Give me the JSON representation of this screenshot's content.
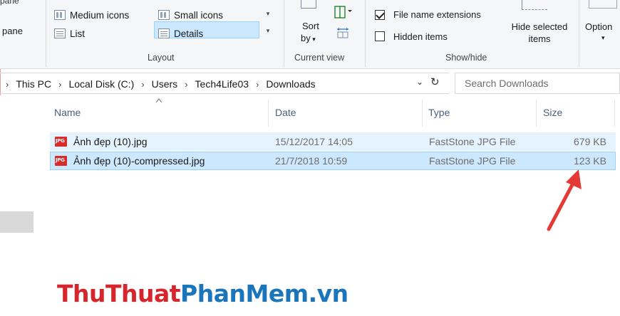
{
  "ribbon": {
    "pane_top": "pane",
    "pane_label": "pane",
    "layout": {
      "medium_icons": "Medium icons",
      "small_icons": "Small icons",
      "list": "List",
      "details": "Details",
      "group_label": "Layout"
    },
    "current_view": {
      "sort_line1": "Sort",
      "sort_line2": "by",
      "group_label": "Current view"
    },
    "show_hide": {
      "file_name_extensions": "File name extensions",
      "file_name_extensions_checked": true,
      "hidden_items": "Hidden items",
      "hidden_items_checked": false,
      "hide_selected_line1": "Hide selected",
      "hide_selected_line2": "items",
      "group_label": "Show/hide"
    },
    "options_label": "Option"
  },
  "address": {
    "crumbs": [
      "This PC",
      "Local Disk (C:)",
      "Users",
      "Tech4Life03",
      "Downloads"
    ],
    "search_placeholder": "Search Downloads"
  },
  "columns": {
    "name": "Name",
    "date": "Date",
    "type": "Type",
    "size": "Size"
  },
  "files": [
    {
      "name": "Ảnh đẹp (10).jpg",
      "date": "15/12/2017 14:05",
      "type": "FastStone JPG File",
      "size": "679 KB",
      "icon": "jpg-file-icon",
      "icon_text": "JPG"
    },
    {
      "name": "Ảnh đẹp (10)-compressed.jpg",
      "date": "21/7/2018 10:59",
      "type": "FastStone JPG File",
      "size": "123 KB",
      "icon": "jpg-file-icon",
      "icon_text": "JPG"
    }
  ],
  "watermark": {
    "part1": "ThuThuat",
    "part2": "PhanMem",
    "part3": ".vn"
  },
  "colors": {
    "selection": "#cce8ff",
    "hover": "#e5f3ff",
    "arrow": "#e53935",
    "watermark_red": "#d6262d",
    "watermark_blue": "#1b75bb"
  }
}
